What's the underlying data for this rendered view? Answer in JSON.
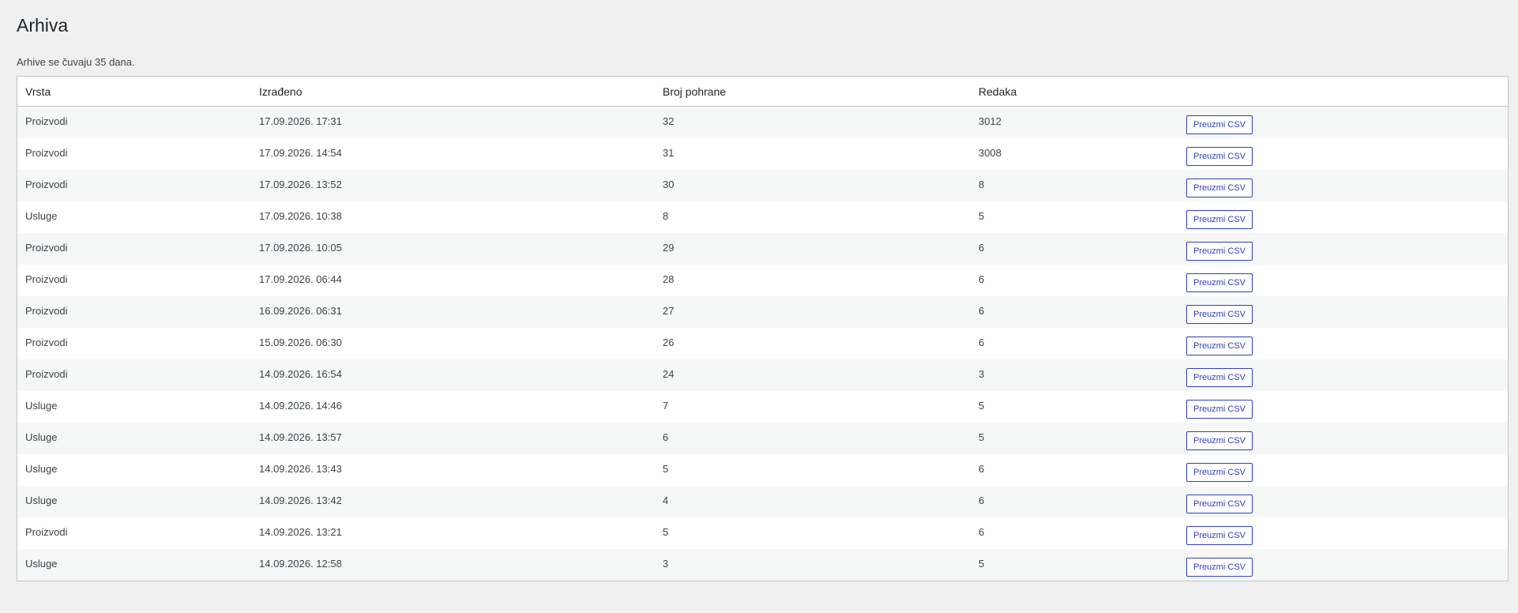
{
  "page": {
    "title": "Arhiva",
    "note": "Arhive se čuvaju 35 dana."
  },
  "table": {
    "headers": [
      "Vrsta",
      "Izrađeno",
      "Broj pohrane",
      "Redaka",
      ""
    ],
    "action_label": "Preuzmi CSV",
    "rows": [
      {
        "vrsta": "Proizvodi",
        "izradeno": "17.09.2026. 17:31",
        "broj": "32",
        "redaka": "3012"
      },
      {
        "vrsta": "Proizvodi",
        "izradeno": "17.09.2026. 14:54",
        "broj": "31",
        "redaka": "3008"
      },
      {
        "vrsta": "Proizvodi",
        "izradeno": "17.09.2026. 13:52",
        "broj": "30",
        "redaka": "8"
      },
      {
        "vrsta": "Usluge",
        "izradeno": "17.09.2026. 10:38",
        "broj": "8",
        "redaka": "5"
      },
      {
        "vrsta": "Proizvodi",
        "izradeno": "17.09.2026. 10:05",
        "broj": "29",
        "redaka": "6"
      },
      {
        "vrsta": "Proizvodi",
        "izradeno": "17.09.2026. 06:44",
        "broj": "28",
        "redaka": "6"
      },
      {
        "vrsta": "Proizvodi",
        "izradeno": "16.09.2026. 06:31",
        "broj": "27",
        "redaka": "6"
      },
      {
        "vrsta": "Proizvodi",
        "izradeno": "15.09.2026. 06:30",
        "broj": "26",
        "redaka": "6"
      },
      {
        "vrsta": "Proizvodi",
        "izradeno": "14.09.2026. 16:54",
        "broj": "24",
        "redaka": "3"
      },
      {
        "vrsta": "Usluge",
        "izradeno": "14.09.2026. 14:46",
        "broj": "7",
        "redaka": "5"
      },
      {
        "vrsta": "Usluge",
        "izradeno": "14.09.2026. 13:57",
        "broj": "6",
        "redaka": "5"
      },
      {
        "vrsta": "Usluge",
        "izradeno": "14.09.2026. 13:43",
        "broj": "5",
        "redaka": "6"
      },
      {
        "vrsta": "Usluge",
        "izradeno": "14.09.2026. 13:42",
        "broj": "4",
        "redaka": "6"
      },
      {
        "vrsta": "Proizvodi",
        "izradeno": "14.09.2026. 13:21",
        "broj": "5",
        "redaka": "6"
      },
      {
        "vrsta": "Usluge",
        "izradeno": "14.09.2026. 12:58",
        "broj": "3",
        "redaka": "5"
      }
    ]
  },
  "colors": {
    "background": "#f0f0f1",
    "table_bg": "#ffffff",
    "row_alt": "#f6f7f7",
    "border": "#c3c4c7",
    "button_accent": "#2f3fbf"
  }
}
